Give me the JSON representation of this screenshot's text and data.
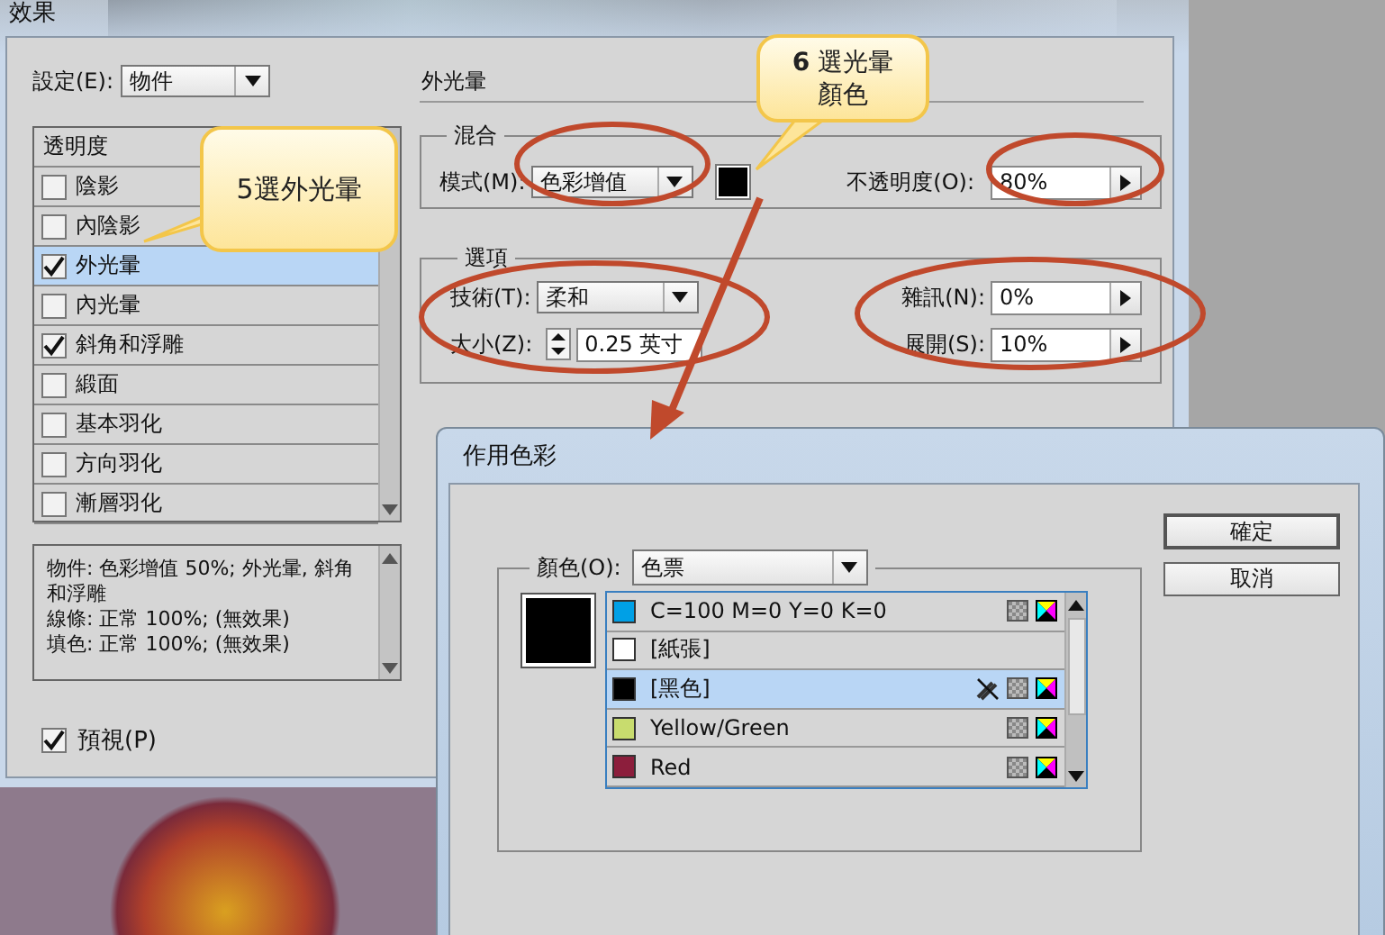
{
  "effects_dialog": {
    "title": "效果",
    "settings_label": "設定(E):",
    "settings_value": "物件",
    "effects_list": {
      "header": "透明度",
      "items": [
        {
          "label": "陰影",
          "checked": false,
          "selected": false
        },
        {
          "label": "內陰影",
          "checked": false,
          "selected": false
        },
        {
          "label": "外光暈",
          "checked": true,
          "selected": true
        },
        {
          "label": "內光暈",
          "checked": false,
          "selected": false
        },
        {
          "label": "斜角和浮雕",
          "checked": true,
          "selected": false
        },
        {
          "label": "緞面",
          "checked": false,
          "selected": false
        },
        {
          "label": "基本羽化",
          "checked": false,
          "selected": false
        },
        {
          "label": "方向羽化",
          "checked": false,
          "selected": false
        },
        {
          "label": "漸層羽化",
          "checked": false,
          "selected": false
        }
      ]
    },
    "summary": [
      "物件: 色彩增值 50%; 外光暈, 斜角和浮雕",
      "線條: 正常 100%; (無效果)",
      "填色: 正常 100%; (無效果)"
    ],
    "preview": {
      "label": "預視(P)",
      "checked": true
    },
    "panel_title": "外光暈",
    "blending": {
      "legend": "混合",
      "mode_label": "模式(M):",
      "mode_value": "色彩增值",
      "opacity_label": "不透明度(O):",
      "opacity_value": "80%"
    },
    "options": {
      "legend": "選項",
      "technique_label": "技術(T):",
      "technique_value": "柔和",
      "size_label": "大小(Z):",
      "size_value": "0.25 英寸",
      "noise_label": "雜訊(N):",
      "noise_value": "0%",
      "spread_label": "展開(S):",
      "spread_value": "10%"
    }
  },
  "swatch_dialog": {
    "title": "作用色彩",
    "color_label": "顏色(O):",
    "color_value": "色票",
    "swatches": [
      {
        "name": "C=100 M=0 Y=0 K=0",
        "color": "#00a0e6",
        "kind": "process",
        "editable": true,
        "selected": false
      },
      {
        "name": "[紙張]",
        "color": "#ffffff",
        "kind": "paper",
        "editable": true,
        "selected": false
      },
      {
        "name": "[黑色]",
        "color": "#000000",
        "kind": "process",
        "editable": false,
        "selected": true
      },
      {
        "name": "Yellow/Green",
        "color": "#c8dc6e",
        "kind": "process",
        "editable": true,
        "selected": false
      },
      {
        "name": "Red",
        "color": "#8c1e3c",
        "kind": "process",
        "editable": true,
        "selected": false
      }
    ],
    "buttons": [
      "確定",
      "取消"
    ]
  },
  "callouts": [
    {
      "lines": [
        "5選外光暈"
      ]
    },
    {
      "lines": [
        "**6** 選光暈",
        "顏色"
      ]
    }
  ]
}
